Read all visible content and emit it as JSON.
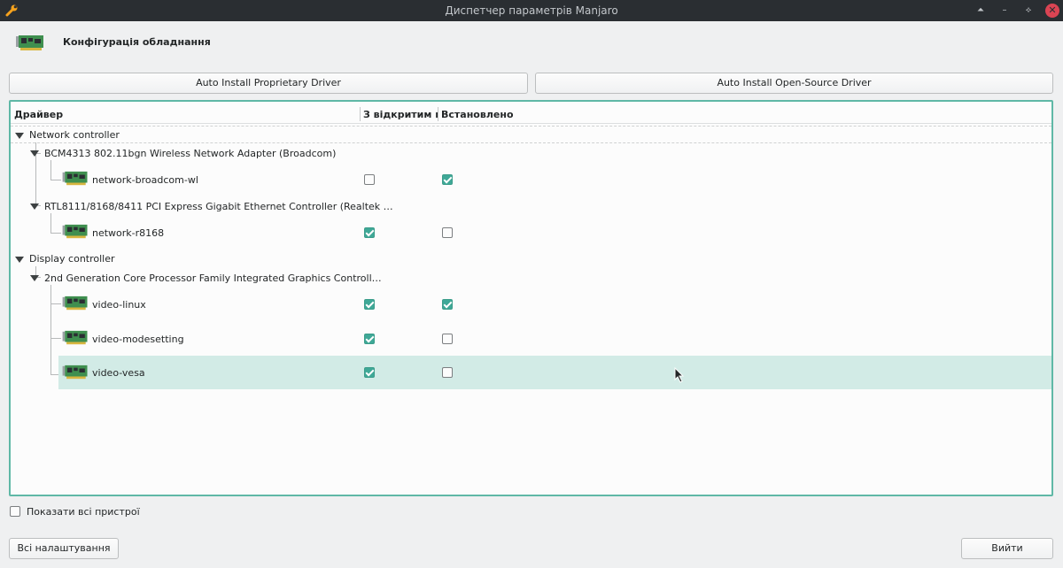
{
  "window": {
    "title": "Диспетчер параметрів Manjaro",
    "controls": {
      "up": "⏶",
      "minimize": "–",
      "restore": "⟡",
      "close": "✕"
    }
  },
  "header": {
    "title": "Конфігурація обладнання",
    "icon": "pci-card-icon"
  },
  "actions": {
    "auto_proprietary": "Auto Install Proprietary Driver",
    "auto_open_source": "Auto Install Open-Source Driver"
  },
  "table": {
    "columns": [
      "Драйвер",
      "З відкритим код",
      "Встановлено"
    ],
    "groups": [
      {
        "label": "Network controller",
        "devices": [
          {
            "label": "BCM4313 802.11bgn Wireless Network Adapter (Broadcom)",
            "drivers": [
              {
                "name": "network-broadcom-wl",
                "open_source": false,
                "installed": true
              }
            ]
          },
          {
            "label": "RTL8111/8168/8411 PCI Express Gigabit Ethernet Controller (Realtek …",
            "drivers": [
              {
                "name": "network-r8168",
                "open_source": true,
                "installed": false
              }
            ]
          }
        ]
      },
      {
        "label": "Display controller",
        "devices": [
          {
            "label": "2nd Generation Core Processor Family Integrated Graphics Controll…",
            "drivers": [
              {
                "name": "video-linux",
                "open_source": true,
                "installed": true
              },
              {
                "name": "video-modesetting",
                "open_source": true,
                "installed": false
              },
              {
                "name": "video-vesa",
                "open_source": true,
                "installed": false,
                "selected": true
              }
            ]
          }
        ]
      }
    ]
  },
  "footer": {
    "show_all_label": "Показати всі пристрої",
    "show_all_checked": false,
    "all_settings": "Всі налаштування",
    "exit": "Вийти"
  },
  "colors": {
    "accent": "#5fb8a6",
    "selection": "#d2ebe6",
    "titlebar": "#2a2e32",
    "close": "#da4453"
  }
}
